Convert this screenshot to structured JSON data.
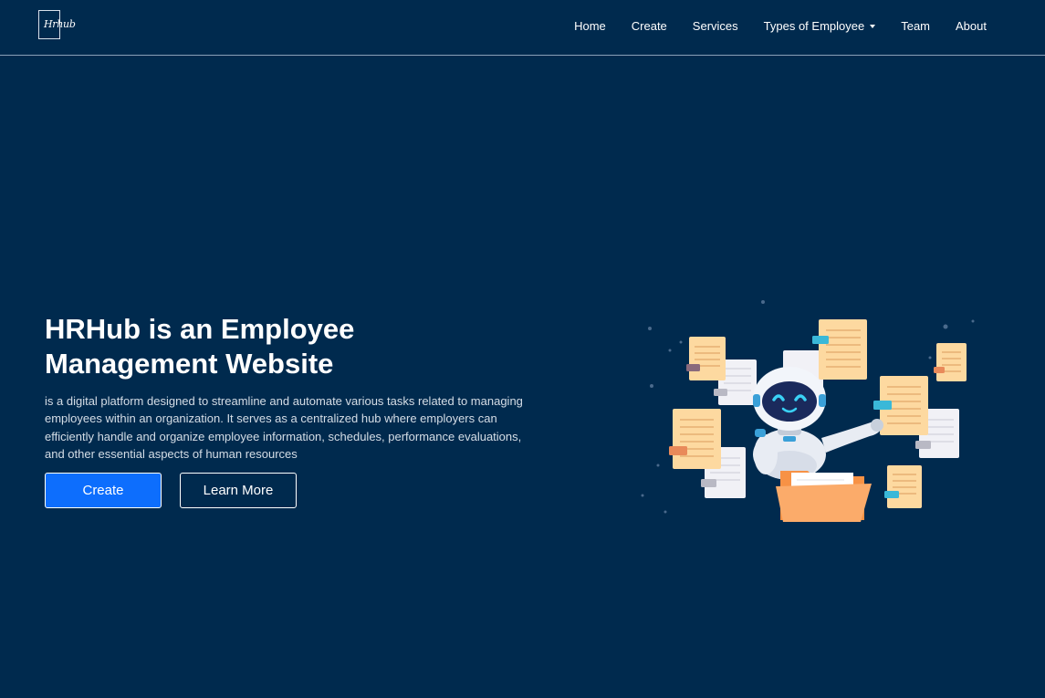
{
  "brand": {
    "logo_text": "Hrhub"
  },
  "nav": {
    "items": [
      {
        "label": "Home"
      },
      {
        "label": "Create"
      },
      {
        "label": "Services"
      },
      {
        "label": "Types of Employee"
      },
      {
        "label": "Team"
      },
      {
        "label": "About"
      }
    ]
  },
  "hero": {
    "title_line1": "HRHub is an Employee",
    "title_line2": "Management Website",
    "description": "is a digital platform designed to streamline and automate various tasks related to managing employees within an organization. It serves as a centralized hub where employers can efficiently handle and organize employee information, schedules, performance evaluations, and other essential aspects of human resources",
    "primary_button": "Create",
    "secondary_button": "Learn More"
  },
  "colors": {
    "background": "#002a4e",
    "primary": "#0d6efd",
    "paper": "#fdd9a0",
    "folder": "#f7a35c",
    "robot_face": "#1a2a5c",
    "robot_eyes": "#3ad1f5"
  },
  "icons": {
    "dropdown": "caret-down-icon",
    "illustration": "robot-with-documents-illustration"
  }
}
